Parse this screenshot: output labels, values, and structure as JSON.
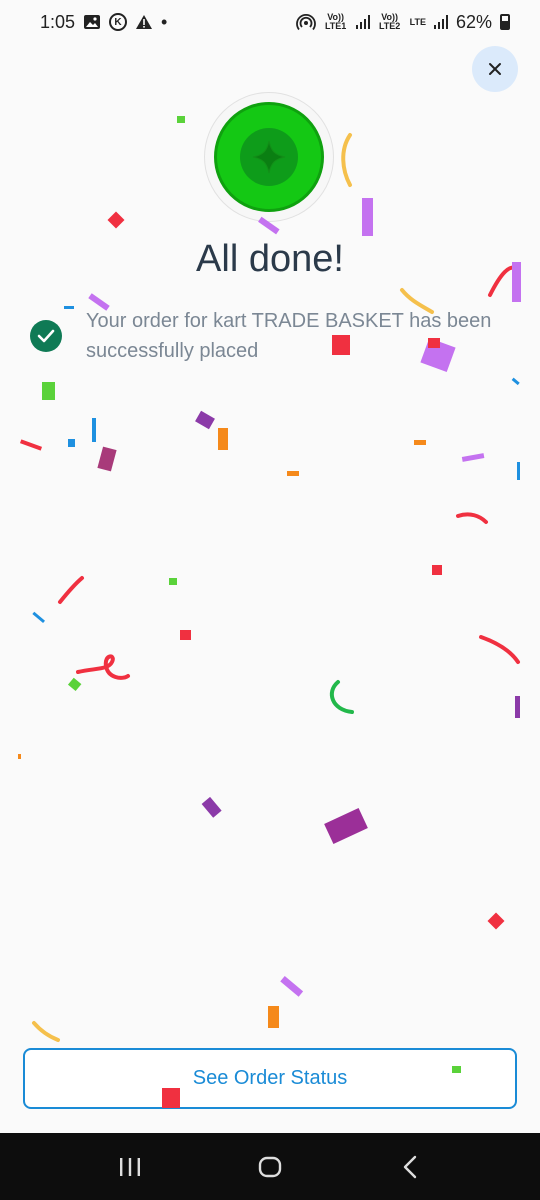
{
  "status_bar": {
    "time": "1:05",
    "k_badge": "K",
    "dot": "•",
    "sim1": "Vo)) LTE1",
    "sim2": "Vo)) LTE2",
    "lte": "LTE",
    "battery": "62%",
    "icons": [
      "image-icon",
      "k-badge-icon",
      "warning-icon",
      "hotspot-icon",
      "signal-icon",
      "battery-icon"
    ]
  },
  "close": {
    "icon": "close-icon"
  },
  "badge": {
    "icon": "sparkle-badge-icon"
  },
  "title": "All done!",
  "message": {
    "icon": "check-circle-icon",
    "text": "Your order for kart TRADE BASKET has been successfully placed"
  },
  "cta": {
    "label": "See Order Status"
  },
  "nav": {
    "items": [
      "recent-apps-icon",
      "home-icon",
      "back-icon"
    ]
  },
  "colors": {
    "accent": "#1a8bd6",
    "success_green": "#14c814",
    "check_green": "#0f7a55",
    "title": "#2b3a4a",
    "close_bg": "#dbeafb"
  }
}
